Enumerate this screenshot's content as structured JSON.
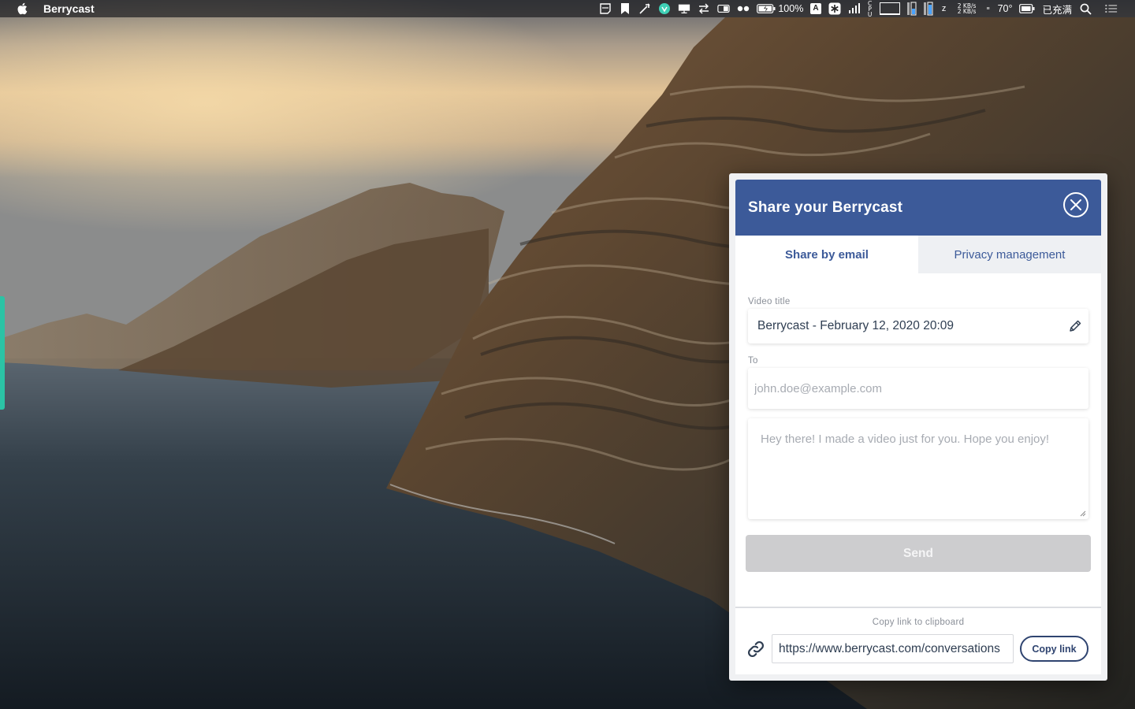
{
  "menubar": {
    "app_name": "Berrycast",
    "battery_percent": "100%",
    "input_source": "A",
    "cpu_label": "C P U",
    "net_up": "2 KB/s",
    "net_down": "2 KB/s",
    "temperature": "70°",
    "charge_status": "已充满",
    "icons": [
      "apple-icon",
      "notes-icon",
      "bookmark-icon",
      "pen-icon",
      "vpn-icon",
      "display-icon",
      "transfer-icon",
      "toggle-icon",
      "dots-icon",
      "battery-icon",
      "input-source-icon",
      "asterisk-icon",
      "signal-icon",
      "cpu-graph-icon",
      "ssd-icon",
      "disk-icon",
      "sleep-icon",
      "network-icon",
      "temp-icon",
      "power-icon",
      "search-icon",
      "list-icon"
    ]
  },
  "share_panel": {
    "title": "Share your Berrycast",
    "tabs": [
      {
        "label": "Share by email",
        "active": true
      },
      {
        "label": "Privacy management",
        "active": false
      }
    ],
    "video_title_label": "Video title",
    "video_title_value": "Berrycast - February 12, 2020 20:09",
    "to_label": "To",
    "email_placeholder": "john.doe@example.com",
    "message_placeholder": "Hey there! I made a video just for you. Hope you enjoy!",
    "send_label": "Send",
    "copy_link_label": "Copy link to clipboard",
    "share_url": "https://www.berrycast.com/conversations",
    "copy_button_label": "Copy link"
  },
  "colors": {
    "header_blue": "#3c5a99",
    "tab_text": "#3c5a99",
    "send_disabled": "#cdcdcf",
    "accent_green": "#2bc3a5"
  }
}
